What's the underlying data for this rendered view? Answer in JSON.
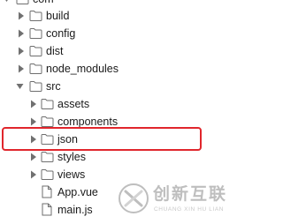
{
  "tree": {
    "items": [
      {
        "label": "com",
        "kind": "folder",
        "expanded": true
      },
      {
        "label": "build",
        "kind": "folder",
        "expanded": false
      },
      {
        "label": "config",
        "kind": "folder",
        "expanded": false
      },
      {
        "label": "dist",
        "kind": "folder",
        "expanded": false
      },
      {
        "label": "node_modules",
        "kind": "folder",
        "expanded": false
      },
      {
        "label": "src",
        "kind": "folder",
        "expanded": true
      },
      {
        "label": "assets",
        "kind": "folder",
        "expanded": false
      },
      {
        "label": "components",
        "kind": "folder",
        "expanded": false
      },
      {
        "label": "json",
        "kind": "folder",
        "expanded": false,
        "highlighted": true
      },
      {
        "label": "styles",
        "kind": "folder",
        "expanded": false
      },
      {
        "label": "views",
        "kind": "folder",
        "expanded": false
      },
      {
        "label": "App.vue",
        "kind": "file"
      },
      {
        "label": "main.js",
        "kind": "file"
      }
    ]
  },
  "highlight_color": "#e0262c",
  "watermark": {
    "title": "创新互联",
    "subtitle": "CHUANG XIN HU LIAN",
    "logo_icon": "x-swirl-logo-icon"
  }
}
